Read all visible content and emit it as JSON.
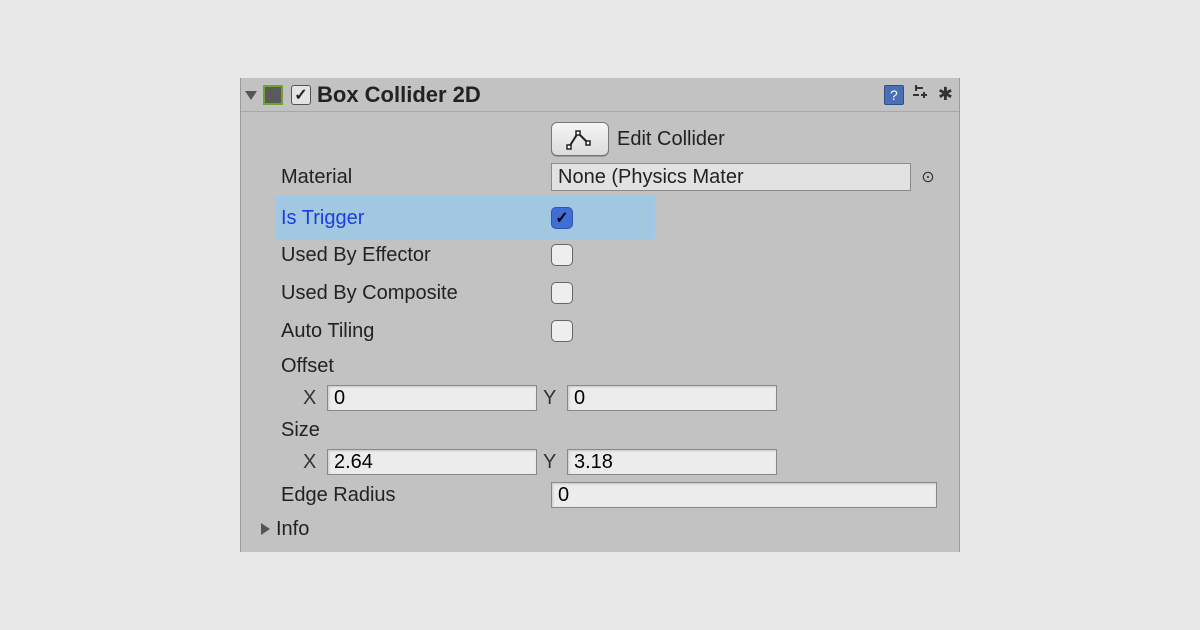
{
  "component": {
    "title": "Box Collider 2D",
    "enabled": true
  },
  "editCollider": {
    "label": "Edit Collider"
  },
  "material": {
    "label": "Material",
    "value": "None (Physics Mater"
  },
  "isTrigger": {
    "label": "Is Trigger",
    "checked": true
  },
  "usedByEffector": {
    "label": "Used By Effector",
    "checked": false
  },
  "usedByComposite": {
    "label": "Used By Composite",
    "checked": false
  },
  "autoTiling": {
    "label": "Auto Tiling",
    "checked": false
  },
  "offset": {
    "label": "Offset",
    "xLabel": "X",
    "yLabel": "Y",
    "x": "0",
    "y": "0"
  },
  "size": {
    "label": "Size",
    "xLabel": "X",
    "yLabel": "Y",
    "x": "2.64",
    "y": "3.18"
  },
  "edgeRadius": {
    "label": "Edge Radius",
    "value": "0"
  },
  "info": {
    "label": "Info"
  }
}
